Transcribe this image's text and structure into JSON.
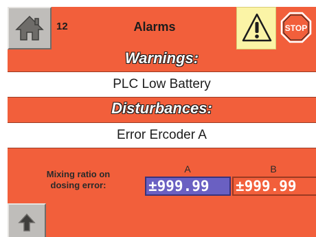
{
  "header": {
    "screen_number": "12",
    "title": "Alarms",
    "home_icon": "home-icon",
    "warning_icon": "warning-triangle-icon",
    "stop_icon": "stop-sign-icon",
    "stop_label": "STOP"
  },
  "warnings": {
    "heading": "Warnings:",
    "message": "PLC Low Battery"
  },
  "disturbances": {
    "heading": "Disturbances:",
    "message": "Error Ercoder A"
  },
  "mixing": {
    "label_line1": "Mixing ratio on",
    "label_line2": "dosing error:",
    "column_a": "A",
    "column_b": "B",
    "value_a": "±999.99",
    "value_b": "±999.99"
  },
  "footer": {
    "up_icon": "up-arrow-icon"
  },
  "colors": {
    "panel": "#f25f3b",
    "button_grey": "#bfbdba",
    "warning_bg": "#fbf4a6",
    "value_a_bg": "#6a60c2"
  }
}
